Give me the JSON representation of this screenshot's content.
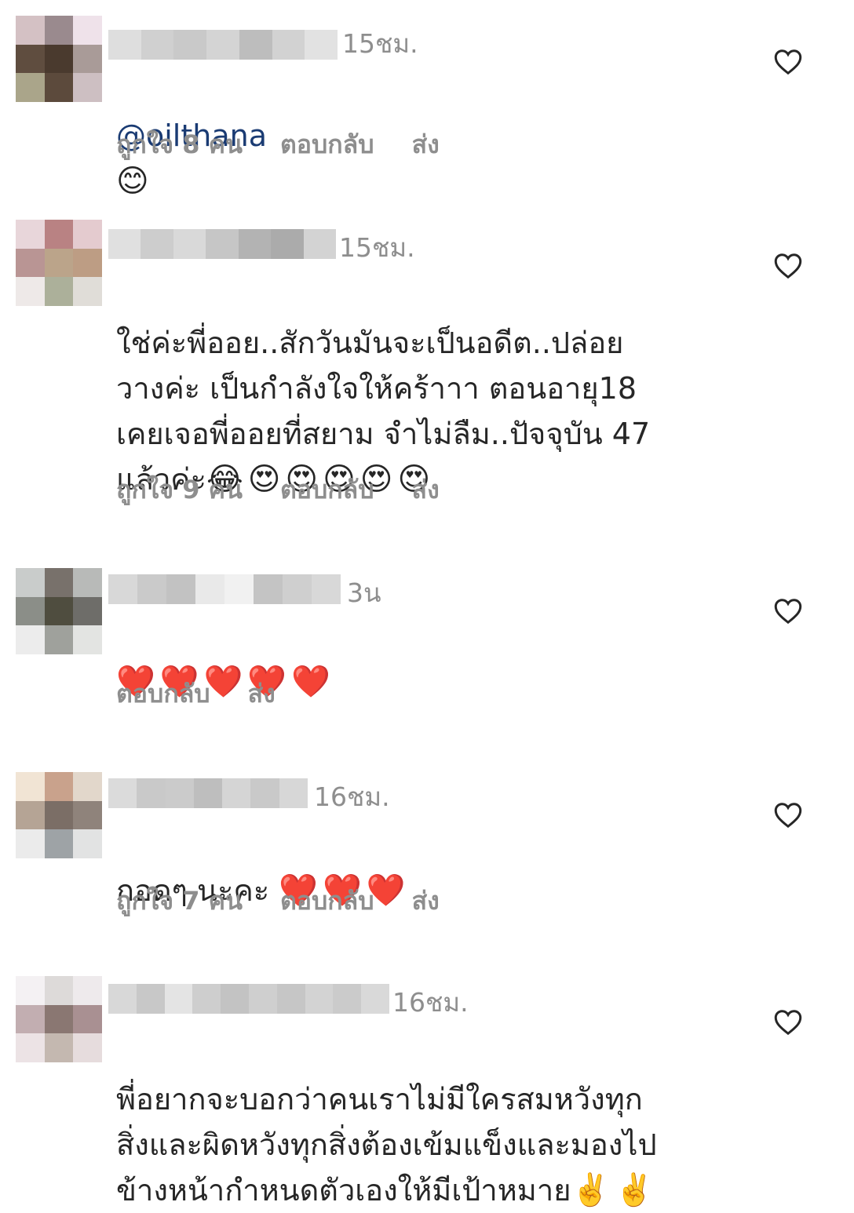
{
  "colors": {
    "text": "#262626",
    "secondary": "#8e8e8e",
    "mention": "#1a3b73",
    "heart_emoji": "#e0202e"
  },
  "labels": {
    "reply": "ตอบกลับ",
    "send": "ส่ง"
  },
  "comments": [
    {
      "time": "15ชม.",
      "mention": "@oilthana",
      "text": "",
      "emoji": "😊",
      "likes": "ถูกใจ 8 คน"
    },
    {
      "time": "15ชม.",
      "mention": "",
      "text": "ใช่ค่ะพี่ออย..สักวันมันจะเป็นอดีต..ปล่อย\nวางค่ะ เป็นกำลังใจให้คร้าาา ตอนอายุ18\nเคยเจอพี่ออยที่สยาม จำไม่ลืม..ปัจจุบัน 47\nแล้วค่ะ",
      "emoji": "😂😍😍😍😍😍",
      "likes": "ถูกใจ 9 คน"
    },
    {
      "time": "3น",
      "mention": "",
      "text": "",
      "emoji": "❤️❤️❤️❤️❤️",
      "likes": ""
    },
    {
      "time": "16ชม.",
      "mention": "",
      "text": "กอดๆ นะคะ ",
      "emoji": "❤️❤️❤️",
      "likes": "ถูกใจ 7 คน"
    },
    {
      "time": "16ชม.",
      "mention": "",
      "text": "พี่อยากจะบอกว่าคนเราไม่มีใครสมหวังทุก\nสิ่งและผิดหวังทุกสิ่งต้องเข้มแข็งและมองไป\nข้างหน้ากำหนดตัวเองให้มีเป้าหมาย",
      "emoji": "✌️✌️",
      "likes": ""
    }
  ]
}
